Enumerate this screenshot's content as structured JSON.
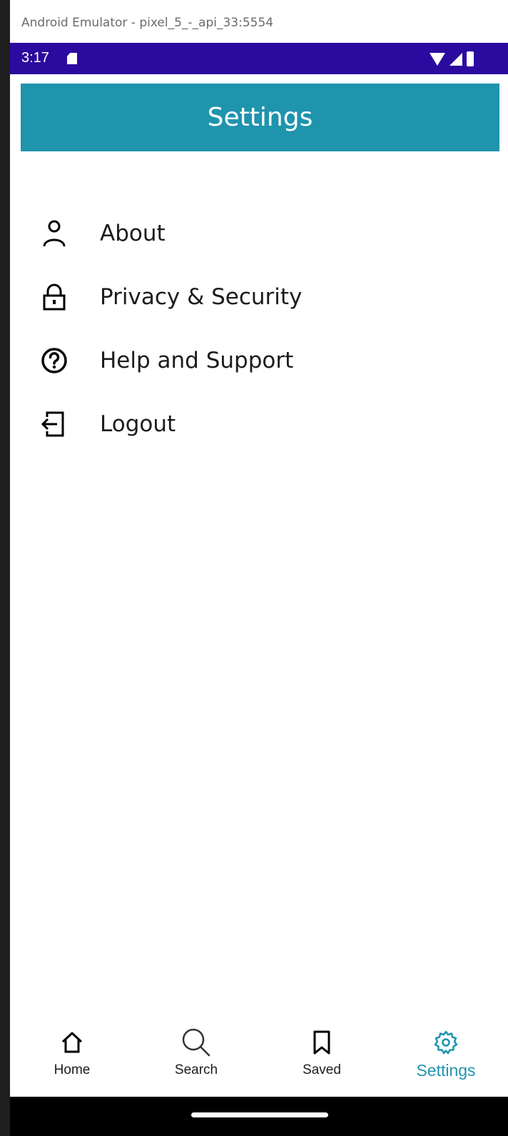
{
  "window": {
    "title": "Android Emulator - pixel_5_-_api_33:5554"
  },
  "status_bar": {
    "time": "3:17",
    "icons": [
      "sd-card-icon",
      "wifi-icon",
      "signal-icon",
      "battery-icon"
    ]
  },
  "app_bar": {
    "title": "Settings"
  },
  "menu": {
    "items": [
      {
        "label": "About",
        "icon": "person-icon"
      },
      {
        "label": "Privacy & Security",
        "icon": "lock-icon"
      },
      {
        "label": "Help and Support",
        "icon": "help-circle-icon"
      },
      {
        "label": "Logout",
        "icon": "logout-icon"
      }
    ]
  },
  "bottom_nav": {
    "items": [
      {
        "label": "Home",
        "icon": "home-icon"
      },
      {
        "label": "Search",
        "icon": "search-icon"
      },
      {
        "label": "Saved",
        "icon": "bookmark-icon"
      },
      {
        "label": "Settings",
        "icon": "gear-icon",
        "active": true
      }
    ]
  },
  "colors": {
    "status_bar": "#2a0a9f",
    "app_bar": "#1e94ad",
    "active_nav": "#1e94ad",
    "text": "#1c1c1c"
  }
}
